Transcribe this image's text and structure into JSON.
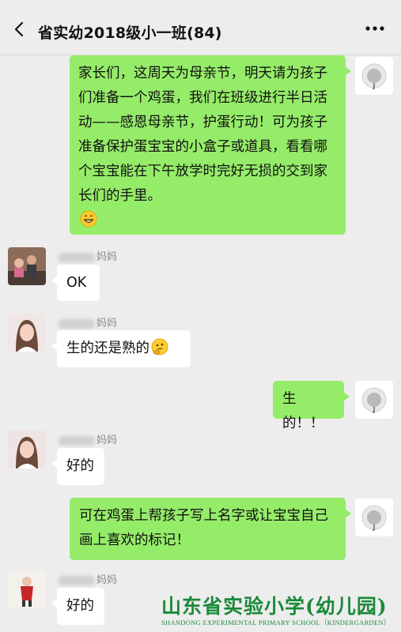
{
  "header": {
    "title": "省实幼2018级小一班(84)"
  },
  "messages": [
    {
      "side": "right",
      "text": "家长们，这周天为母亲节，明天请为孩子们准备一个鸡蛋，我们在班级进行半日活动——感恩母亲节，护蛋行动！可为孩子准备保护蛋宝宝的小盒子或道具，看看哪个宝宝能在下午放学时完好无损的交到家长们的手里。",
      "emoji": "grinning-face"
    },
    {
      "side": "left",
      "sender_suffix": "妈妈",
      "text": "OK"
    },
    {
      "side": "left",
      "sender_suffix": "妈妈",
      "text": "生的还是熟的",
      "emoji": "thinking-face"
    },
    {
      "side": "right",
      "text": "生的！！"
    },
    {
      "side": "left",
      "sender_suffix": "妈妈",
      "text": "好的"
    },
    {
      "side": "right",
      "text": "可在鸡蛋上帮孩子写上名字或让宝宝自己画上喜欢的标记！"
    },
    {
      "side": "left",
      "sender_suffix": "妈妈",
      "text": "好的"
    }
  ],
  "watermark": {
    "main": "山东省实验小学(幼儿园)",
    "sub": "SHANDONG EXPERIMENTAL PRIMARY SCHOOL（KINDERGARDEN）"
  },
  "colors": {
    "accent_green_bubble": "#95ec69",
    "background": "#ededed",
    "watermark_green": "#1b8a3a"
  }
}
